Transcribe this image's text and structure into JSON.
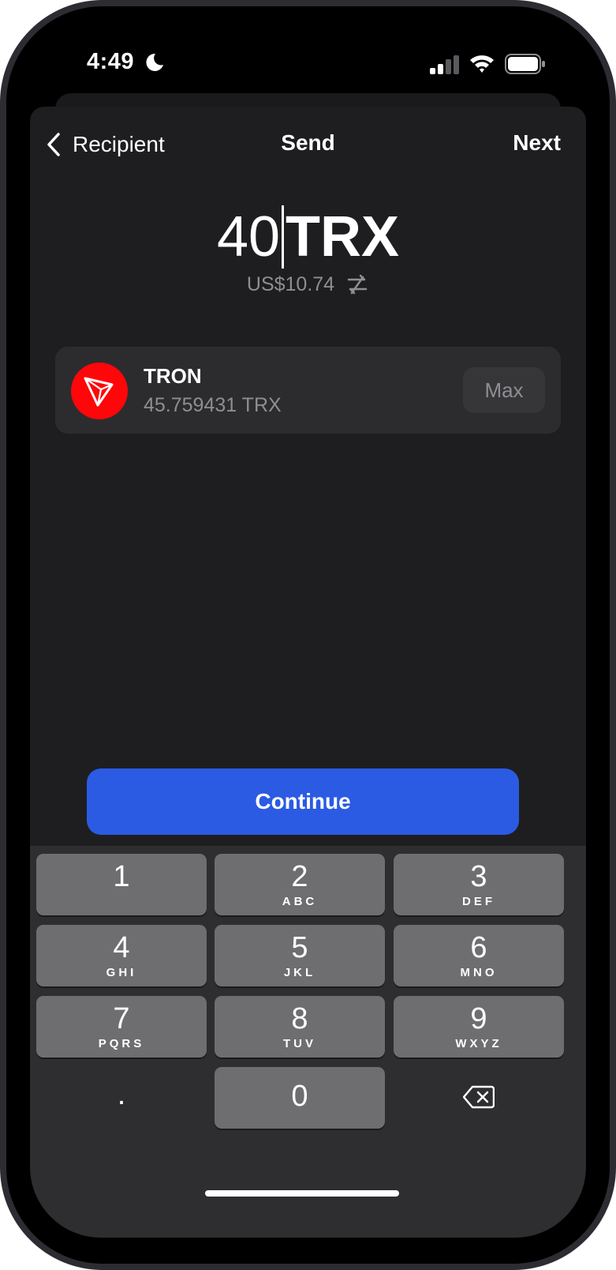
{
  "status_bar": {
    "time": "4:49",
    "icons": [
      "moon-icon",
      "cellular-signal-icon",
      "wifi-icon",
      "battery-icon"
    ]
  },
  "nav": {
    "back_label": "Recipient",
    "title": "Send",
    "next_label": "Next"
  },
  "amount": {
    "value": "40",
    "unit": "TRX",
    "fiat": "US$10.74"
  },
  "asset": {
    "name": "TRON",
    "balance": "45.759431 TRX",
    "max_label": "Max",
    "logo_color": "#ff060a"
  },
  "continue_label": "Continue",
  "keypad": {
    "keys": [
      {
        "digit": "1",
        "letters": ""
      },
      {
        "digit": "2",
        "letters": "ABC"
      },
      {
        "digit": "3",
        "letters": "DEF"
      },
      {
        "digit": "4",
        "letters": "GHI"
      },
      {
        "digit": "5",
        "letters": "JKL"
      },
      {
        "digit": "6",
        "letters": "MNO"
      },
      {
        "digit": "7",
        "letters": "PQRS"
      },
      {
        "digit": "8",
        "letters": "TUV"
      },
      {
        "digit": "9",
        "letters": "WXYZ"
      }
    ],
    "decimal": ".",
    "zero": "0"
  },
  "colors": {
    "accent": "#2b5be3",
    "background": "#1e1e20",
    "card": "#2c2c2e",
    "secondary_text": "#8e8e93"
  }
}
